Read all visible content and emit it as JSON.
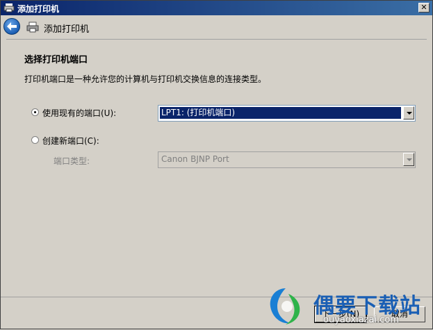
{
  "window": {
    "title": "添加打印机",
    "close_label": "✕"
  },
  "nav": {
    "title": "添加打印机"
  },
  "content": {
    "heading": "选择打印机端口",
    "description": "打印机端口是一种允许您的计算机与打印机交换信息的连接类型。",
    "option_existing": {
      "label": "使用现有的端口(U):",
      "selected": true,
      "value": "LPT1: (打印机端口)"
    },
    "option_new": {
      "label": "创建新端口(C):",
      "selected": false
    },
    "port_type": {
      "label": "端口类型:",
      "value": "Canon BJNP Port"
    }
  },
  "footer": {
    "next_label": "下一步(N)",
    "cancel_label": "取消"
  },
  "watermark": {
    "brand": "偶要下载站",
    "url": "ouyaoxiazai.com"
  },
  "colors": {
    "titlebar": "#0a246a",
    "selection": "#0a246a",
    "face": "#d4d0c8"
  }
}
